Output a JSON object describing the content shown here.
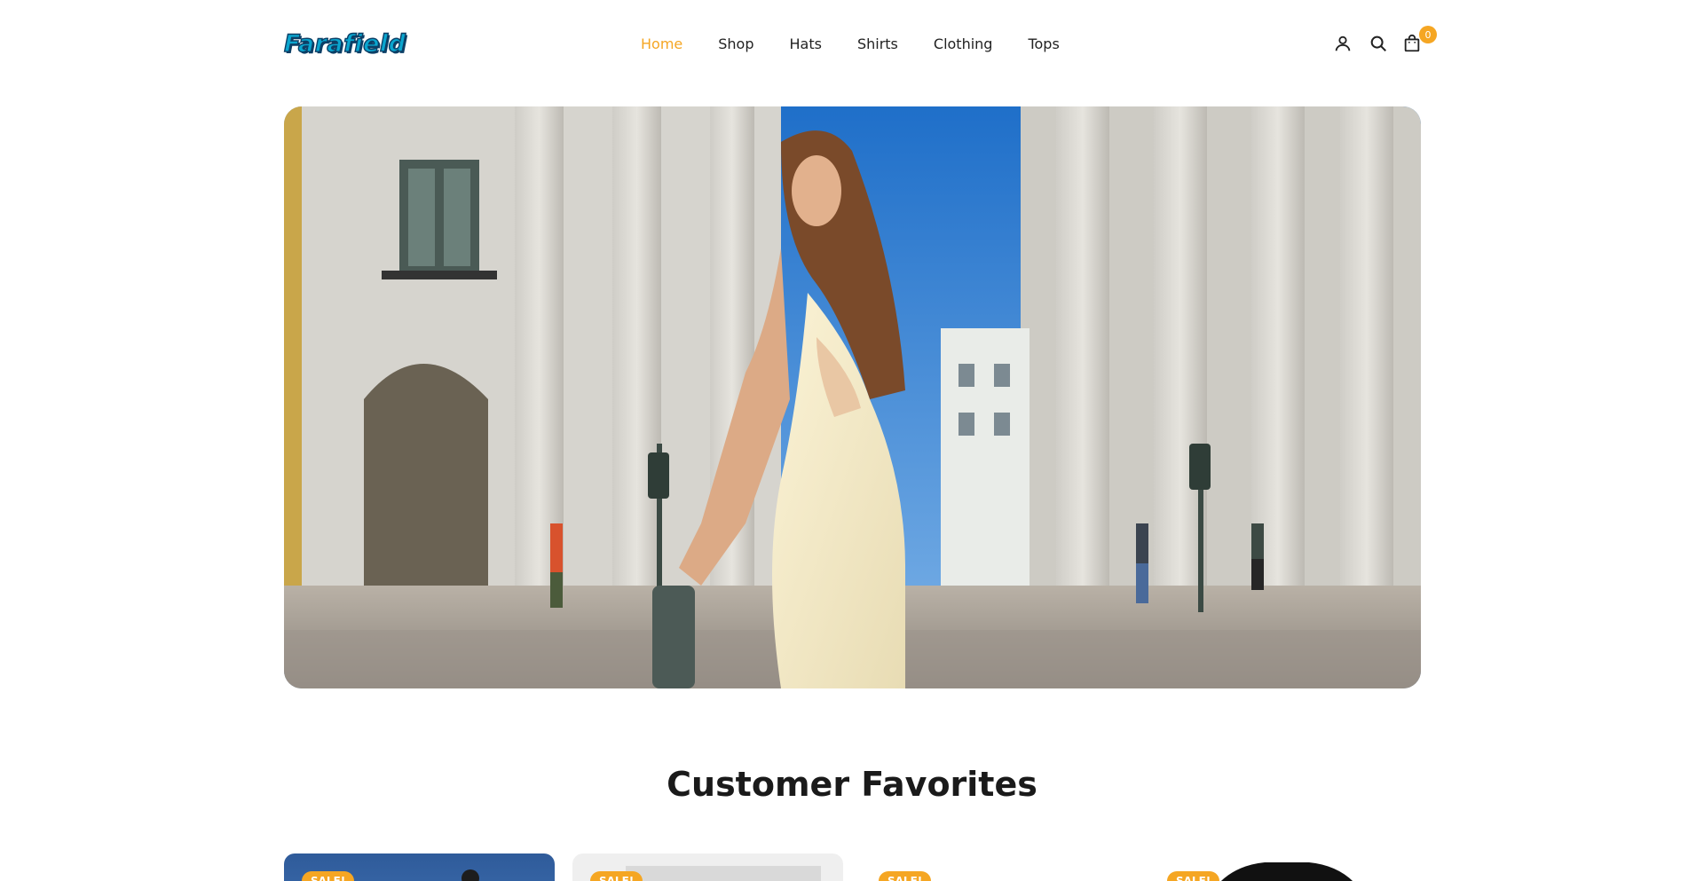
{
  "brand": {
    "logo_text": "Farafield"
  },
  "nav": {
    "items": [
      {
        "label": "Home",
        "active": true
      },
      {
        "label": "Shop"
      },
      {
        "label": "Hats"
      },
      {
        "label": "Shirts"
      },
      {
        "label": "Clothing"
      },
      {
        "label": "Tops"
      }
    ]
  },
  "header_icons": {
    "account": "user-icon",
    "search": "search-icon",
    "cart": "shopping-bag-icon",
    "cart_count": "0"
  },
  "hero": {
    "image": "woman-in-white-dress-city-square-photo"
  },
  "section": {
    "title": "Customer Favorites"
  },
  "products": [
    {
      "badge": "SALE!"
    },
    {
      "badge": "SALE!"
    },
    {
      "badge": "SALE!"
    },
    {
      "badge": "SALE!"
    }
  ],
  "colors": {
    "accent": "#f5a623",
    "text": "#222222"
  }
}
